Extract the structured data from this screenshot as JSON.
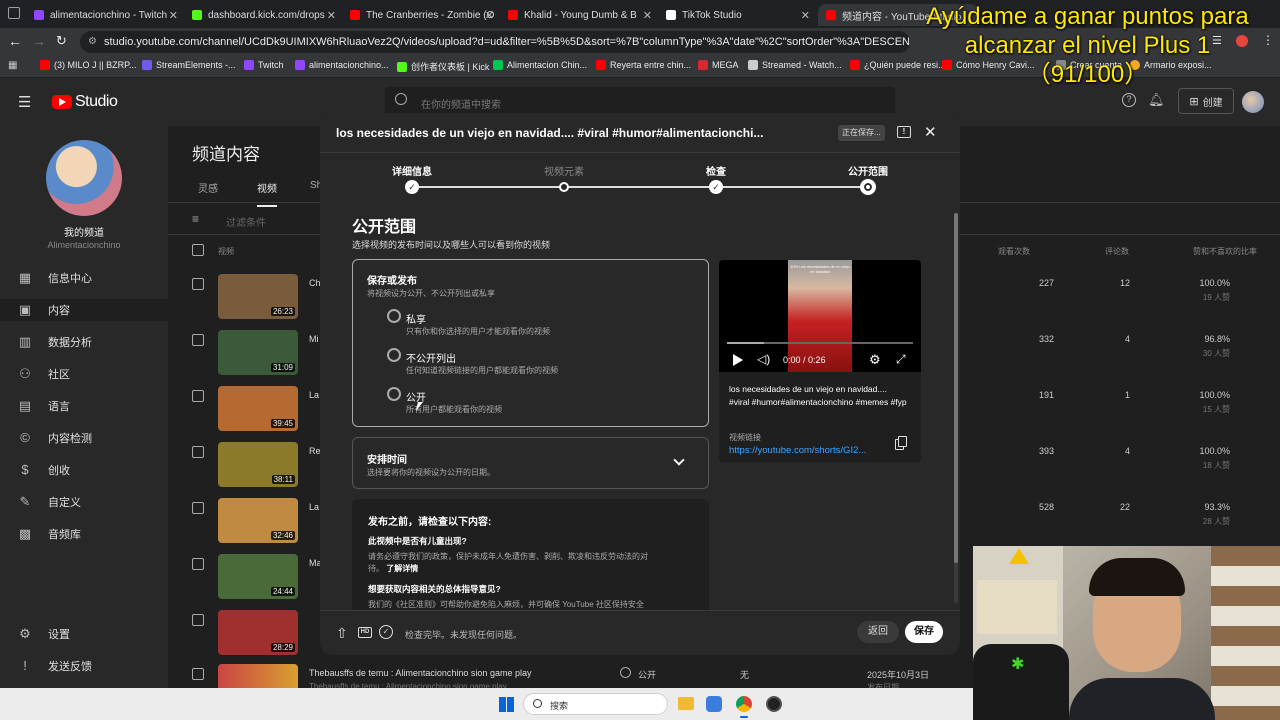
{
  "browser": {
    "tabs": [
      {
        "label": "alimentacionchino - Twitch",
        "color": "#9146ff"
      },
      {
        "label": "dashboard.kick.com/drops",
        "color": "#53fc18"
      },
      {
        "label": "The Cranberries - Zombie (O",
        "color": "#ff0000"
      },
      {
        "label": "Khalid - Young Dumb & B",
        "color": "#ff0000"
      },
      {
        "label": "TikTok Studio",
        "color": "#ffffff"
      },
      {
        "label": "频道内容 - YouTube Studio",
        "color": "#ff0000"
      }
    ],
    "url": "studio.youtube.com/channel/UCdDk9UIMIXW6hRluaoVez2Q/videos/upload?d=ud&filter=%5B%5D&sort=%7B\"columnType\"%3A\"date\"%2C\"sortOrder\"%3A\"DESCENDING\"%7D",
    "bookmarks": [
      {
        "label": "(3) MILO J || BZRP...",
        "color": "#ff0000"
      },
      {
        "label": "StreamElements -...",
        "color": "#6c5ce7"
      },
      {
        "label": "Twitch",
        "color": "#9146ff"
      },
      {
        "label": "alimentacionchino...",
        "color": "#9146ff"
      },
      {
        "label": "创作者仪表板 | Kick",
        "color": "#53fc18"
      },
      {
        "label": "Alimentacion Chin...",
        "color": "#00c853"
      },
      {
        "label": "Reyerta entre chin...",
        "color": "#ff0000"
      },
      {
        "label": "MEGA",
        "color": "#d9272e"
      },
      {
        "label": "Streamed - Watch...",
        "color": "#cccccc"
      },
      {
        "label": "¿Quién puede resi...",
        "color": "#ff0000"
      },
      {
        "label": "Cómo Henry Cavi...",
        "color": "#ff0000"
      },
      {
        "label": "Crear cuenta",
        "color": "#888888"
      },
      {
        "label": "Armario exposi...",
        "color": "#f9a825"
      }
    ]
  },
  "studio": {
    "logo": "Studio",
    "search_placeholder": "在你的频道中搜索",
    "create_label": "创建",
    "channel_title": "我的频道",
    "channel_name": "Alimentacionchino",
    "nav": [
      {
        "label": "信息中心",
        "icon": "dashboard-icon"
      },
      {
        "label": "内容",
        "icon": "content-icon"
      },
      {
        "label": "数据分析",
        "icon": "analytics-icon"
      },
      {
        "label": "社区",
        "icon": "community-icon"
      },
      {
        "label": "语言",
        "icon": "subtitles-icon"
      },
      {
        "label": "内容检测",
        "icon": "copyright-icon"
      },
      {
        "label": "创收",
        "icon": "monetization-icon"
      },
      {
        "label": "自定义",
        "icon": "customization-icon"
      },
      {
        "label": "音频库",
        "icon": "audio-library-icon"
      }
    ],
    "nav_bottom": [
      {
        "label": "设置",
        "icon": "gear-icon"
      },
      {
        "label": "发送反馈",
        "icon": "feedback-icon"
      }
    ],
    "page_title": "频道内容",
    "tabs": [
      "灵感",
      "视频",
      "Sh"
    ],
    "filter_placeholder": "过滤条件",
    "columns": {
      "video": "视频",
      "views": "观看次数",
      "comments": "评论数",
      "likes": "赞和不喜欢的比率"
    },
    "rows": [
      {
        "duration": "26:23",
        "title_start": "Ch",
        "views": "227",
        "comments": "12",
        "ratio": "100.0%",
        "likes": "19 人赞",
        "thumb": "#7a5b3c"
      },
      {
        "duration": "31:09",
        "title_start": "Mi",
        "views": "332",
        "comments": "4",
        "ratio": "96.8%",
        "likes": "30 人赞",
        "thumb": "#3b5a3a"
      },
      {
        "duration": "39:45",
        "title_start": "La",
        "views": "191",
        "comments": "1",
        "ratio": "100.0%",
        "likes": "15 人赞",
        "thumb": "#b46a30"
      },
      {
        "duration": "38:11",
        "title_start": "Re",
        "views": "393",
        "comments": "4",
        "ratio": "100.0%",
        "likes": "18 人赞",
        "thumb": "#8a7a2a"
      },
      {
        "duration": "32:46",
        "title_start": "La",
        "views": "528",
        "comments": "22",
        "ratio": "93.3%",
        "likes": "28 人赞",
        "thumb": "#c08a40"
      },
      {
        "duration": "24:44",
        "title_start": "Ma",
        "views": "",
        "comments": "",
        "ratio": "",
        "likes": "",
        "thumb": "#4a6a3a"
      },
      {
        "duration": "28:29",
        "title_start": "",
        "views": "",
        "comments": "",
        "ratio": "",
        "likes": "",
        "thumb": "#a03030"
      }
    ],
    "last_row": {
      "title": "Thebausffs de temu : Alimentacionchino sion game play",
      "subtitle": "Thebausffs de temu : Alimentacionchino sion game play",
      "visibility": "公开",
      "restrictions": "无",
      "date": "2025年10月3日",
      "date_sub": "发布日期"
    }
  },
  "dialog": {
    "title": "los necesidades de un viejo en navidad.... #viral #humor#alimentacionchi...",
    "saving_badge": "正在保存...",
    "steps": [
      "详细信息",
      "视频元素",
      "检查",
      "公开范围"
    ],
    "section_title": "公开范围",
    "section_subtitle": "选择视频的发布时间以及哪些人可以看到你的视频",
    "save_publish": {
      "title": "保存或发布",
      "subtitle": "将视频设为公开、不公开列出或私享",
      "options": [
        {
          "label": "私享",
          "desc": "只有你和你选择的用户才能观看你的视频"
        },
        {
          "label": "不公开列出",
          "desc": "任何知道视频链接的用户都能观看你的视频"
        },
        {
          "label": "公开",
          "desc": "所有用户都能观看你的视频"
        }
      ]
    },
    "schedule": {
      "title": "安排时间",
      "desc": "选择要将你的视频设为公开的日期。"
    },
    "before_publish": {
      "title": "发布之前，请检查以下内容:",
      "q1": "此视频中是否有儿童出现?",
      "q1_text": "请务必遵守我们的政策，保护未成年人免遭伤害、剥削、欺凌和违反劳动法的对待。",
      "q1_link": "了解详情",
      "q2": "想要获取内容相关的总体指导意见?",
      "q2_text": "我们的《社区准则》可帮助你避免陷入麻烦，并可确保 YouTube 社区保持安全"
    },
    "preview": {
      "time": "0:00 / 0:26",
      "thumb_caption": "10% Las necesidades de un viejo en navidad",
      "title_text": "los necesidades de un viejo en navidad.... #viral #humor#alimentacionchino #memes #fyp",
      "link_label": "视频链接",
      "link": "https://youtube.com/shorts/GI2..."
    },
    "footer": {
      "status": "检查完毕。未发现任何问题。",
      "back": "返回",
      "save": "保存"
    }
  },
  "overlay": {
    "line1": "Ayúdame a ganar puntos para",
    "line2": "alcanzar el nivel Plus 1",
    "line3": "（91/100）"
  },
  "taskbar": {
    "search": "搜索"
  }
}
